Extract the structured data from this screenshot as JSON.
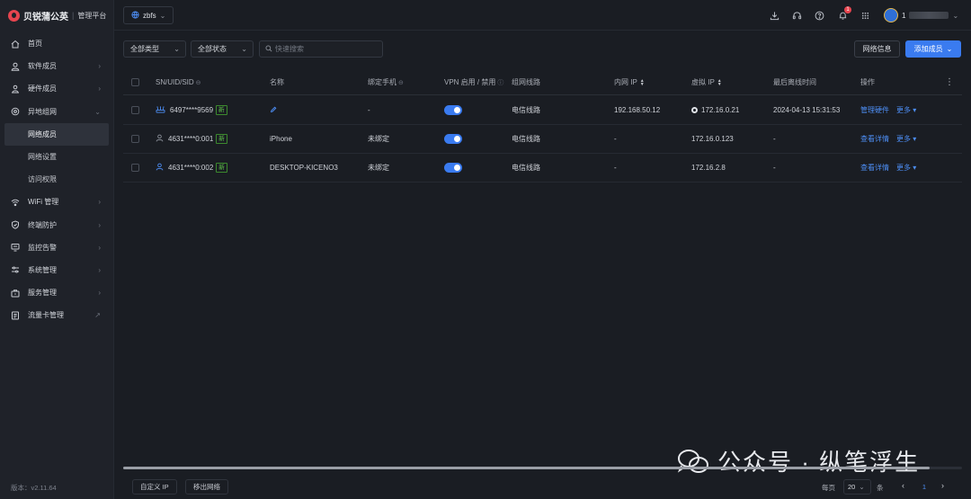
{
  "brand": {
    "name": "贝锐蒲公英",
    "separator": "|",
    "subtitle": "管理平台"
  },
  "sidebar": {
    "items": [
      {
        "label": "首页",
        "icon": "home-icon",
        "chevron": false
      },
      {
        "label": "软件成员",
        "icon": "user-icon",
        "chevron": true
      },
      {
        "label": "硬件成员",
        "icon": "device-user-icon",
        "chevron": true
      },
      {
        "label": "异地组网",
        "icon": "network-icon",
        "chevron": true,
        "expanded": true
      }
    ],
    "sub_items": [
      {
        "label": "网络成员",
        "active": true
      },
      {
        "label": "网络设置",
        "active": false
      },
      {
        "label": "访问权限",
        "active": false
      }
    ],
    "items_after": [
      {
        "label": "WiFi 管理",
        "icon": "wifi-icon"
      },
      {
        "label": "终端防护",
        "icon": "shield-icon"
      },
      {
        "label": "监控告警",
        "icon": "monitor-icon"
      },
      {
        "label": "系统管理",
        "icon": "sliders-icon"
      },
      {
        "label": "服务管理",
        "icon": "briefcase-icon"
      },
      {
        "label": "流量卡管理",
        "icon": "sim-card-icon",
        "external": true
      }
    ],
    "version": "版本：v2.11.64"
  },
  "topbar": {
    "workspace": "zbfs",
    "notification_count": "1",
    "user_name": "1"
  },
  "toolbar": {
    "type_select": "全部类型",
    "status_select": "全部状态",
    "search_placeholder": "快速搜索",
    "network_info_button": "网络信息",
    "add_member_button": "添加成员"
  },
  "table": {
    "columns": {
      "sn": "SN/UID/SID",
      "name": "名称",
      "phone": "绑定手机",
      "vpn": "VPN 启用 / 禁用",
      "route": "组网线路",
      "lan_ip": "内网 IP",
      "virtual_ip": "虚拟 IP",
      "last_offline": "最后离线时间",
      "actions": "操作"
    },
    "rows": [
      {
        "sn": "6497****9569",
        "tag": "新",
        "name": "",
        "phone": "-",
        "vpn": true,
        "route": "电信线路",
        "lan_ip": "192.168.50.12",
        "virtual_ip": "172.16.0.21",
        "last_offline": "2024-04-13 15:31:53",
        "action": "管理硬件",
        "more": "更多"
      },
      {
        "sn": "4631****0:001",
        "tag": "新",
        "name": "iPhone",
        "phone": "未绑定",
        "vpn": true,
        "route": "电信线路",
        "lan_ip": "-",
        "virtual_ip": "172.16.0.123",
        "last_offline": "-",
        "action": "查看详情",
        "more": "更多"
      },
      {
        "sn": "4631****0:002",
        "tag": "新",
        "name": "DESKTOP-KICENO3",
        "phone": "未绑定",
        "vpn": true,
        "route": "电信线路",
        "lan_ip": "-",
        "virtual_ip": "172.16.2.8",
        "last_offline": "-",
        "action": "查看详情",
        "more": "更多"
      }
    ]
  },
  "footer": {
    "custom_ip_button": "自定义 IP",
    "remove_button": "移出网络",
    "per_page_label": "每页",
    "per_page_value": "20",
    "per_page_unit": "条",
    "current_page": "1"
  },
  "watermark": {
    "text": "公众号 · 纵笔浮生"
  },
  "colors": {
    "accent": "#3a7bf0",
    "brand": "#e8454f",
    "new_tag": "#5fc24a",
    "background": "#1a1d23",
    "sidebar": "#1f2229"
  }
}
